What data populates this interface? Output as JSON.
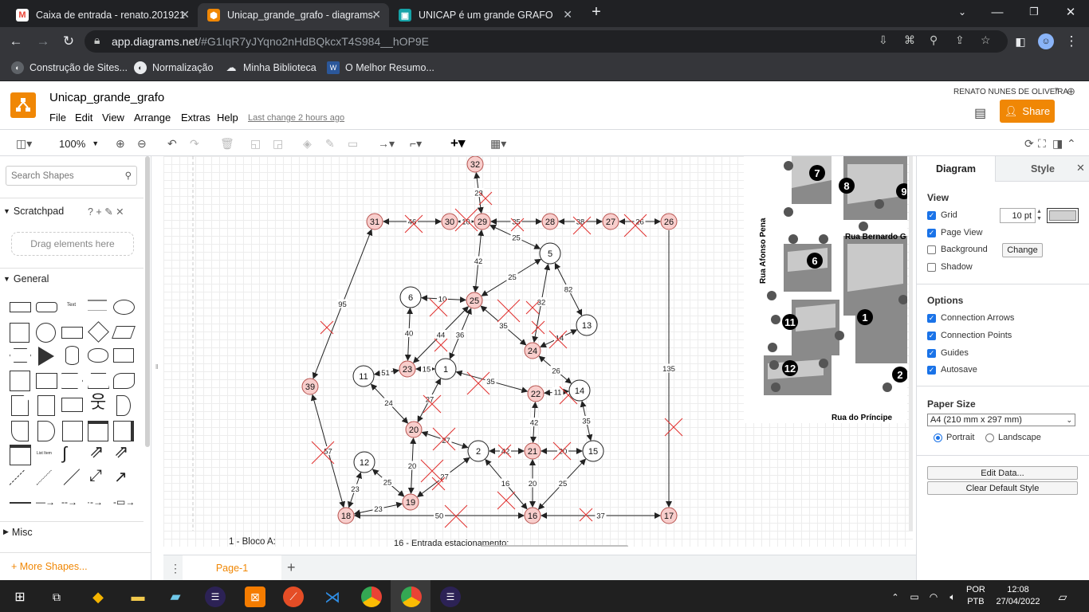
{
  "browser": {
    "tabs": [
      {
        "title": "Caixa de entrada - renato.201921",
        "icon": "gmail-icon",
        "icon_color": "#ea4335"
      },
      {
        "title": "Unicap_grande_grafo - diagrams.",
        "icon": "drawio-icon",
        "icon_color": "#f08705"
      },
      {
        "title": "UNICAP é um grande GRAFO",
        "icon": "classroom-icon",
        "icon_color": "#16a3a8"
      }
    ],
    "url_host": "app.diagrams.net",
    "url_rest": "/#G1IqR7yJYqno2nHdBQkcxT4S984__hOP9E",
    "bookmarks": [
      "Construção de Sites...",
      "Normalização",
      "Minha Biblioteca",
      "O Melhor Resumo..."
    ]
  },
  "app": {
    "title": "Unicap_grande_grafo",
    "menu": [
      "File",
      "Edit",
      "View",
      "Arrange",
      "Extras",
      "Help"
    ],
    "last_change": "Last change 2 hours ago",
    "user": "RENATO NUNES DE OLIVEIRA",
    "share": "Share",
    "zoom": "100%"
  },
  "left": {
    "search_placeholder": "Search Shapes",
    "scratchpad": "Scratchpad",
    "scratch_actions": "? + ✎ ✕",
    "drag_hint": "Drag elements here",
    "general": "General",
    "misc": "Misc",
    "more_shapes": "+ More Shapes..."
  },
  "right": {
    "tab_diagram": "Diagram",
    "tab_style": "Style",
    "view_title": "View",
    "grid": "Grid",
    "grid_size": "10 pt",
    "page_view": "Page View",
    "background": "Background",
    "change": "Change",
    "shadow": "Shadow",
    "options_title": "Options",
    "connection_arrows": "Connection Arrows",
    "connection_points": "Connection Points",
    "guides": "Guides",
    "autosave": "Autosave",
    "paper_title": "Paper Size",
    "paper_value": "A4 (210 mm x 297 mm)",
    "portrait": "Portrait",
    "landscape": "Landscape",
    "edit_data": "Edit Data...",
    "clear_style": "Clear Default Style"
  },
  "page_tab": "Page-1",
  "canvas": {
    "legend_1": "1 - Bloco A:",
    "legend_16": "16 - Entrada estacionamento:",
    "map_labels": [
      "Rua Afonso Pena",
      "Rua Bernardo G",
      "Rua do Príncipe"
    ],
    "map_numbers": [
      "7",
      "8",
      "9",
      "6",
      "1",
      "11",
      "12",
      "2"
    ]
  },
  "graph": {
    "nodes": [
      {
        "id": "32",
        "pink": true
      },
      {
        "id": "31",
        "pink": true
      },
      {
        "id": "30",
        "pink": true
      },
      {
        "id": "29",
        "pink": true
      },
      {
        "id": "28",
        "pink": true
      },
      {
        "id": "27",
        "pink": true
      },
      {
        "id": "26",
        "pink": true
      },
      {
        "id": "5",
        "pink": false
      },
      {
        "id": "6",
        "pink": false
      },
      {
        "id": "25",
        "pink": true
      },
      {
        "id": "13",
        "pink": false
      },
      {
        "id": "24",
        "pink": true
      },
      {
        "id": "11",
        "pink": false
      },
      {
        "id": "23",
        "pink": true
      },
      {
        "id": "1",
        "pink": false
      },
      {
        "id": "39",
        "pink": true
      },
      {
        "id": "22",
        "pink": true
      },
      {
        "id": "14",
        "pink": false
      },
      {
        "id": "20",
        "pink": true
      },
      {
        "id": "2",
        "pink": false
      },
      {
        "id": "21",
        "pink": true
      },
      {
        "id": "15",
        "pink": false
      },
      {
        "id": "12",
        "pink": false
      },
      {
        "id": "19",
        "pink": true
      },
      {
        "id": "18",
        "pink": true
      },
      {
        "id": "16",
        "pink": true
      },
      {
        "id": "17",
        "pink": true
      }
    ],
    "edge_labels": [
      "23",
      "46",
      "10",
      "35",
      "38",
      "26",
      "25",
      "42",
      "32",
      "25",
      "82",
      "95",
      "10",
      "40",
      "44",
      "36",
      "35",
      "14",
      "51",
      "15",
      "35",
      "26",
      "11",
      "135",
      "27",
      "24",
      "42",
      "27",
      "20",
      "20",
      "57",
      "23",
      "25",
      "27",
      "16",
      "20",
      "25",
      "35",
      "50",
      "37"
    ]
  },
  "taskbar": {
    "lang1": "POR",
    "lang2": "PTB",
    "time": "12:08",
    "date": "27/04/2022"
  }
}
